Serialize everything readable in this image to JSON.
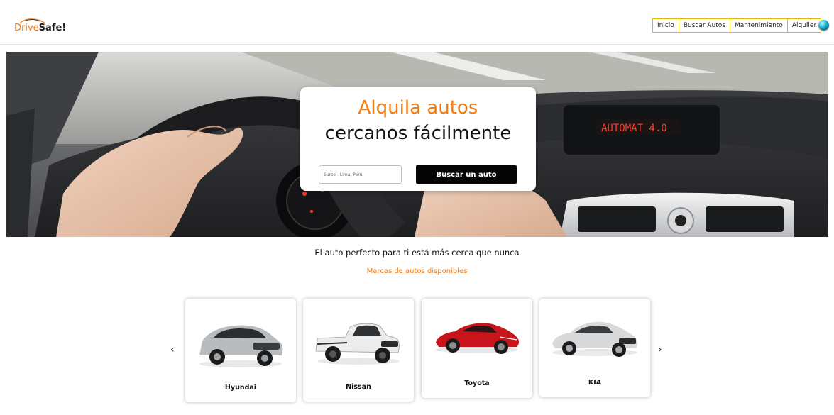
{
  "header": {
    "logo": {
      "part1": "Drive",
      "part2": "Safe!"
    },
    "nav": [
      "Inicio",
      "Buscar Autos",
      "Mantenimiento",
      "Alquiler"
    ],
    "globe_icon": "globe-icon"
  },
  "hero": {
    "title_line1": "Alquila autos",
    "title_line2": "cercanos fácilmente",
    "search_placeholder": "Surco - Lima, Perú",
    "search_button": "Buscar un auto",
    "accent_color": "#f47b12"
  },
  "section": {
    "tagline": "El auto perfecto para ti está más cerca que nunca",
    "brands_title": "Marcas de autos disponibles"
  },
  "carousel": {
    "prev_icon": "chevron-left-icon",
    "next_icon": "chevron-right-icon",
    "brands": [
      {
        "name": "Hyundai",
        "car_color": "#b9bcbe"
      },
      {
        "name": "Nissan",
        "car_color": "#ececec"
      },
      {
        "name": "Toyota",
        "car_color": "#c8151b"
      },
      {
        "name": "KIA",
        "car_color": "#d7d9db"
      }
    ]
  }
}
